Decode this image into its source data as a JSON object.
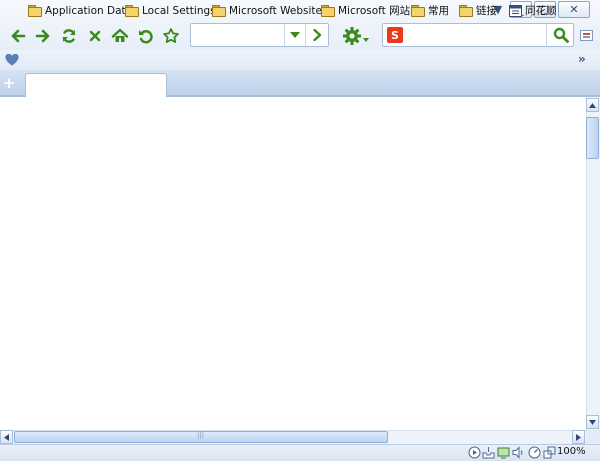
{
  "window": {
    "menu_arrow": "▼",
    "minimize": "_",
    "maximize": "□",
    "close": "✕"
  },
  "toolbar": {
    "buttons": [
      "back-icon",
      "forward-icon",
      "refresh-icon",
      "stop-icon",
      "home-icon",
      "undo-close-icon",
      "favorite-star-icon"
    ],
    "address": {
      "value": "",
      "placeholder": ""
    },
    "search": {
      "engine_label": "S",
      "value": "",
      "placeholder": ""
    },
    "icon_color": "#3a8a1e"
  },
  "bookmarks": {
    "items": [
      {
        "label": "Application Data"
      },
      {
        "label": "Local Settings"
      },
      {
        "label": "Microsoft Websites"
      },
      {
        "label": "Microsoft 网站"
      },
      {
        "label": "常用"
      },
      {
        "label": "链接"
      },
      {
        "label": "同花顺"
      }
    ],
    "more": "»"
  },
  "tabs": [
    {
      "label": ""
    }
  ],
  "tabbar": {
    "new_tab": "+"
  },
  "status": {
    "zoom": "100%"
  }
}
